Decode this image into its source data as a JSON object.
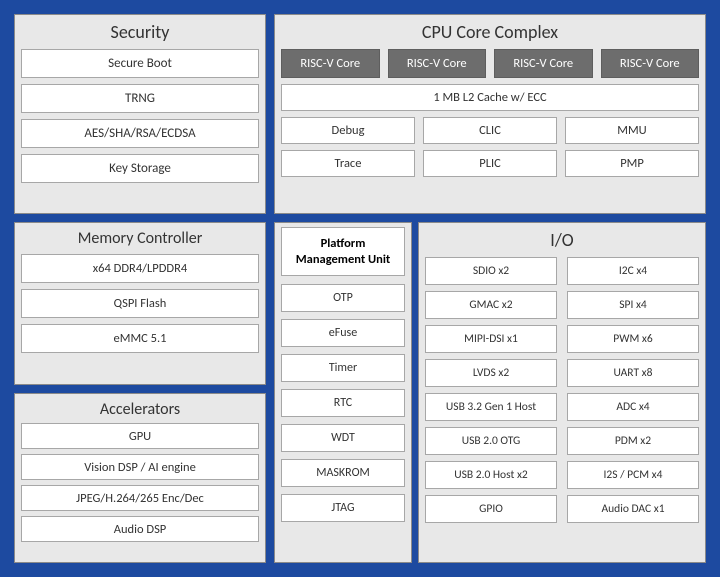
{
  "security": {
    "title": "Security",
    "items": [
      "Secure Boot",
      "TRNG",
      "AES/SHA/RSA/ECDSA",
      "Key Storage"
    ]
  },
  "cpu": {
    "title": "CPU Core Complex",
    "cores": [
      "RISC-V Core",
      "RISC-V Core",
      "RISC-V Core",
      "RISC-V Core"
    ],
    "l2": "1 MB L2 Cache w/ ECC",
    "row_a": [
      "Debug",
      "CLIC",
      "MMU"
    ],
    "row_b": [
      "Trace",
      "PLIC",
      "PMP"
    ]
  },
  "memory": {
    "title": "Memory Controller",
    "items": [
      "x64 DDR4/LPDDR4",
      "QSPI Flash",
      "eMMC 5.1"
    ]
  },
  "accel": {
    "title": "Accelerators",
    "items": [
      "GPU",
      "Vision DSP / AI engine",
      "JPEG/H.264/265 Enc/Dec",
      "Audio DSP"
    ]
  },
  "pmu": {
    "head": "Platform Management Unit",
    "items": [
      "OTP",
      "eFuse",
      "Timer",
      "RTC",
      "WDT",
      "MASKROM",
      "JTAG"
    ]
  },
  "io": {
    "title": "I/O",
    "left": [
      "SDIO x2",
      "GMAC x2",
      "MIPI-DSI x1",
      "LVDS x2",
      "USB 3.2 Gen 1 Host",
      "USB 2.0 OTG",
      "USB 2.0 Host x2",
      "GPIO"
    ],
    "right": [
      "I2C x4",
      "SPI x4",
      "PWM x6",
      "UART x8",
      "ADC x4",
      "PDM x2",
      "I2S / PCM x4",
      "Audio DAC x1"
    ]
  }
}
